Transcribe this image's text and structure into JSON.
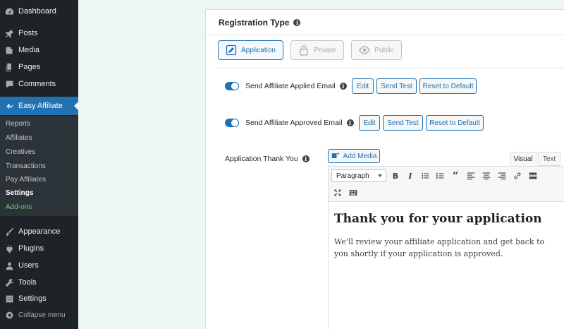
{
  "sidebar": {
    "items": [
      {
        "label": "Dashboard",
        "icon": "dashboard-icon"
      },
      {
        "label": "Posts",
        "icon": "pushpin-icon"
      },
      {
        "label": "Media",
        "icon": "media-icon"
      },
      {
        "label": "Pages",
        "icon": "pages-icon"
      },
      {
        "label": "Comments",
        "icon": "comment-icon"
      },
      {
        "label": "Easy Affiliate",
        "icon": "affiliate-icon"
      },
      {
        "label": "Appearance",
        "icon": "brush-icon"
      },
      {
        "label": "Plugins",
        "icon": "plugin-icon"
      },
      {
        "label": "Users",
        "icon": "user-icon"
      },
      {
        "label": "Tools",
        "icon": "wrench-icon"
      },
      {
        "label": "Settings",
        "icon": "settings-icon"
      },
      {
        "label": "Collapse menu",
        "icon": "collapse-icon"
      }
    ],
    "submenu": [
      "Reports",
      "Affiliates",
      "Creatives",
      "Transactions",
      "Pay Affiliates",
      "Settings",
      "Add-ons"
    ]
  },
  "registration": {
    "title": "Registration Type",
    "info_glyph": "i",
    "options": [
      "Application",
      "Private",
      "Public"
    ]
  },
  "emails": [
    {
      "label": "Send Affiliate Applied Email",
      "enabled": true
    },
    {
      "label": "Send Affiliate Approved Email",
      "enabled": true
    }
  ],
  "buttons": {
    "edit": "Edit",
    "send_test": "Send Test",
    "reset": "Reset to Default"
  },
  "thank_you": {
    "label": "Application Thank You",
    "add_media": "Add Media",
    "tab_visual": "Visual",
    "tab_text": "Text",
    "format": "Paragraph",
    "toolbar": {
      "bold": "B",
      "italic": "I",
      "quote": "“"
    },
    "heading": "Thank you for your application",
    "body": "We'll review your affiliate application and get back to you shortly if your application is approved."
  },
  "colors": {
    "accent": "#2271b1",
    "sidebar": "#1d2327"
  }
}
